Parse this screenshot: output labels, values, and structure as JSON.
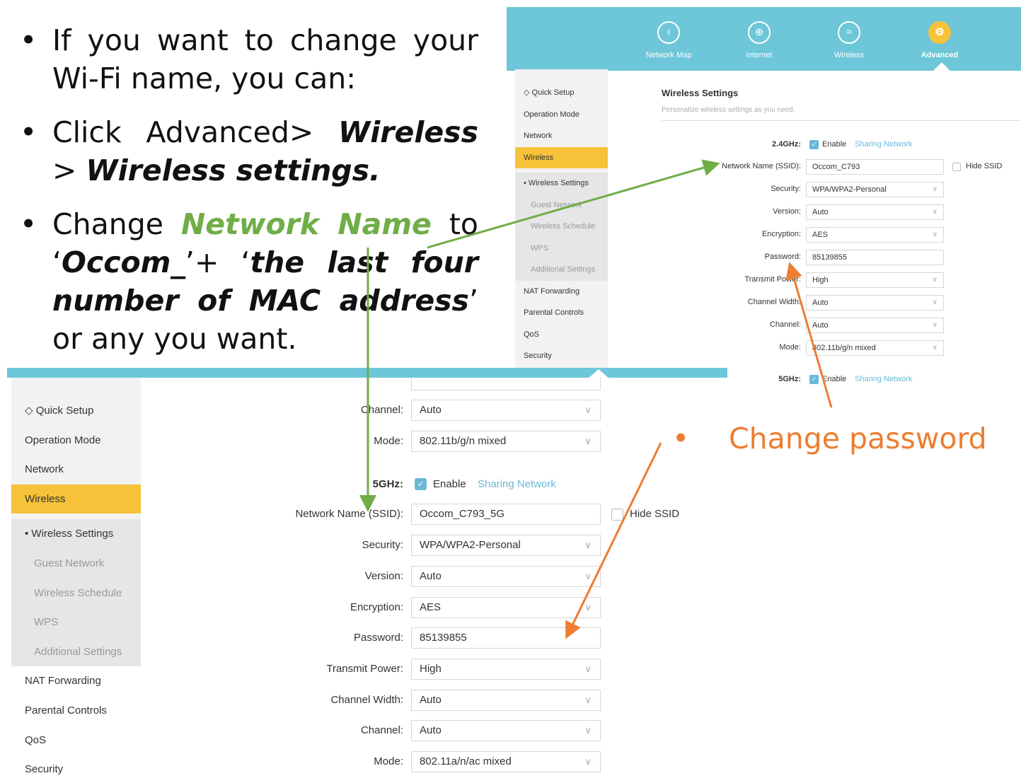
{
  "slide": {
    "bullet1": "If you want to change your Wi-Fi name, you can:",
    "bullet2_pre": "Click Advanced> ",
    "bullet2_wireless": "Wireless",
    "bullet2_sep": " > ",
    "bullet2_settings": "Wireless settings.",
    "bullet3_change": "Change ",
    "bullet3_network_name": "Network Name",
    "bullet3_to": " to",
    "bullet3_q1": "‘",
    "bullet3_occom": "Occom_",
    "bullet3_plus": "’+ ‘",
    "bullet3_last": "the last four number of MAC address",
    "bullet3_or": "’ or any you want.",
    "callout": "Change password",
    "bullet_glyph": "•"
  },
  "top_nav": [
    {
      "label": "Network Map",
      "icon": "network-map-icon",
      "glyph": "♁"
    },
    {
      "label": "Internet",
      "icon": "globe-icon",
      "glyph": "⊕"
    },
    {
      "label": "Wireless",
      "icon": "wifi-icon",
      "glyph": "≈"
    },
    {
      "label": "Advanced",
      "icon": "gear-icon",
      "glyph": "⚙"
    }
  ],
  "sidebar": {
    "quick_setup": "Quick Setup",
    "quick_setup_icon": "◇",
    "operation_mode": "Operation Mode",
    "network": "Network",
    "wireless": "Wireless",
    "wireless_settings": "• Wireless Settings",
    "guest_network": "Guest Network",
    "wireless_schedule": "Wireless Schedule",
    "wps": "WPS",
    "additional_settings": "Additional Settings",
    "nat_forwarding": "NAT Forwarding",
    "parental_controls": "Parental Controls",
    "qos": "QoS",
    "security": "Security"
  },
  "page": {
    "title": "Wireless Settings",
    "subtitle": "Personalize wireless settings as you need."
  },
  "labels": {
    "ssid": "Network Name (SSID):",
    "security": "Security:",
    "version": "Version:",
    "encryption": "Encryption:",
    "password": "Password:",
    "transmit_power": "Transmit Power:",
    "channel_width": "Channel Width:",
    "channel": "Channel:",
    "mode": "Mode:",
    "enable": "Enable",
    "sharing_network": "Sharing Network",
    "hide_ssid": "Hide SSID",
    "check": "✓",
    "chevron": "∨"
  },
  "band_24": {
    "label": "2.4GHz:",
    "ssid": "Occom_C793",
    "security": "WPA/WPA2-Personal",
    "version": "Auto",
    "encryption": "AES",
    "password": "85139855",
    "transmit_power": "High",
    "channel_width": "Auto",
    "channel": "Auto",
    "mode": "802.11b/g/n mixed"
  },
  "band_5": {
    "label": "5GHz:",
    "ssid": "Occom_C793_5G",
    "security": "WPA/WPA2-Personal",
    "version": "Auto",
    "encryption": "AES",
    "password": "85139855",
    "transmit_power": "High",
    "channel_width": "Auto",
    "channel": "Auto",
    "mode": "802.11a/n/ac mixed"
  },
  "colors": {
    "header": "#6ec6d9",
    "active_yellow": "#f6c23a",
    "link_blue": "#6bb8d6",
    "arrow_green": "#70ad47",
    "arrow_orange": "#ed7d31"
  }
}
